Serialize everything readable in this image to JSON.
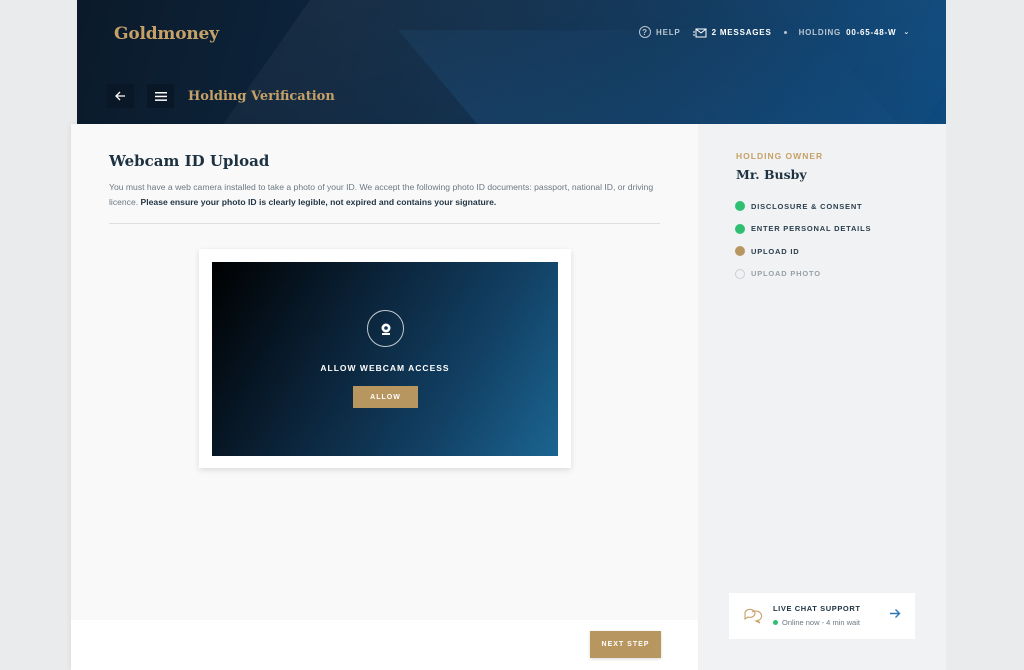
{
  "brand": {
    "logo": "Goldmoney"
  },
  "topnav": {
    "help": "HELP",
    "messages": "2 MESSAGES",
    "holding_label": "HOLDING",
    "holding_id": "00-65-48-W"
  },
  "page": {
    "title": "Holding Verification"
  },
  "upload": {
    "heading": "Webcam ID Upload",
    "description": "You must have a web camera installed to take a photo of your ID. We accept the following photo ID documents: passport, national ID, or driving licence.",
    "description_bold": "Please ensure your photo ID is clearly legible, not expired and contains your signature.",
    "webcam_label": "ALLOW WEBCAM ACCESS",
    "allow_button": "ALLOW",
    "next_button": "NEXT STEP"
  },
  "sidebar": {
    "owner_label": "HOLDING OWNER",
    "owner_name": "Mr. Busby",
    "steps": [
      {
        "label": "DISCLOSURE & CONSENT",
        "status": "complete",
        "color": "#2fbf71"
      },
      {
        "label": "ENTER PERSONAL DETAILS",
        "status": "complete",
        "color": "#2fbf71"
      },
      {
        "label": "UPLOAD ID",
        "status": "current",
        "color": "#b89660"
      },
      {
        "label": "UPLOAD PHOTO",
        "status": "pending",
        "color": "#c9cfd4"
      }
    ],
    "chat": {
      "title": "LIVE CHAT SUPPORT",
      "status": "Online now - 4 min wait"
    }
  },
  "colors": {
    "gold": "#c6a167",
    "button_gold": "#b89660",
    "navy": "#0c3357",
    "green": "#2fbf71"
  }
}
